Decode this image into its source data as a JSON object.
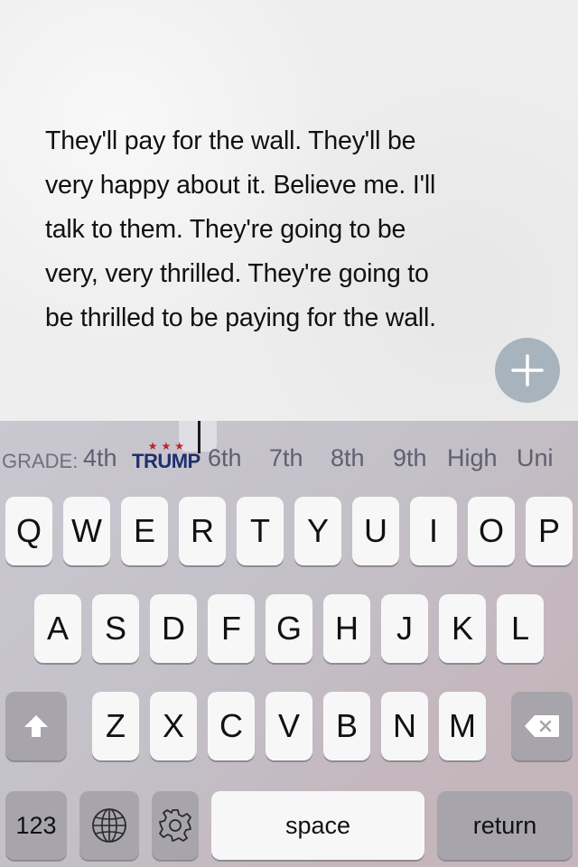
{
  "note": {
    "lines": [
      "They'll pay for the wall. They'll be",
      "very happy about it. Believe me. I'll",
      "talk to them. They're going to be",
      "very, very thrilled. They're going to",
      "be thrilled to be paying for the wall."
    ]
  },
  "fab": {
    "icon": "plus-icon",
    "color": "#a8b4bd"
  },
  "grade_bar": {
    "label": "GRADE:",
    "levels": [
      "4th",
      "TRUMP",
      "6th",
      "7th",
      "8th",
      "9th",
      "High",
      "Uni"
    ],
    "trump_stars": "★★★",
    "selected": "TRUMP"
  },
  "keyboard": {
    "row1": [
      "Q",
      "W",
      "E",
      "R",
      "T",
      "Y",
      "U",
      "I",
      "O",
      "P"
    ],
    "row2": [
      "A",
      "S",
      "D",
      "F",
      "G",
      "H",
      "J",
      "K",
      "L"
    ],
    "row3": [
      "Z",
      "X",
      "C",
      "V",
      "B",
      "N",
      "M"
    ],
    "shift_icon": "shift-arrow-icon",
    "delete_icon": "backspace-icon",
    "numbers_label": "123",
    "globe_icon": "globe-icon",
    "settings_icon": "gear-icon",
    "space_label": "space",
    "return_label": "return"
  }
}
